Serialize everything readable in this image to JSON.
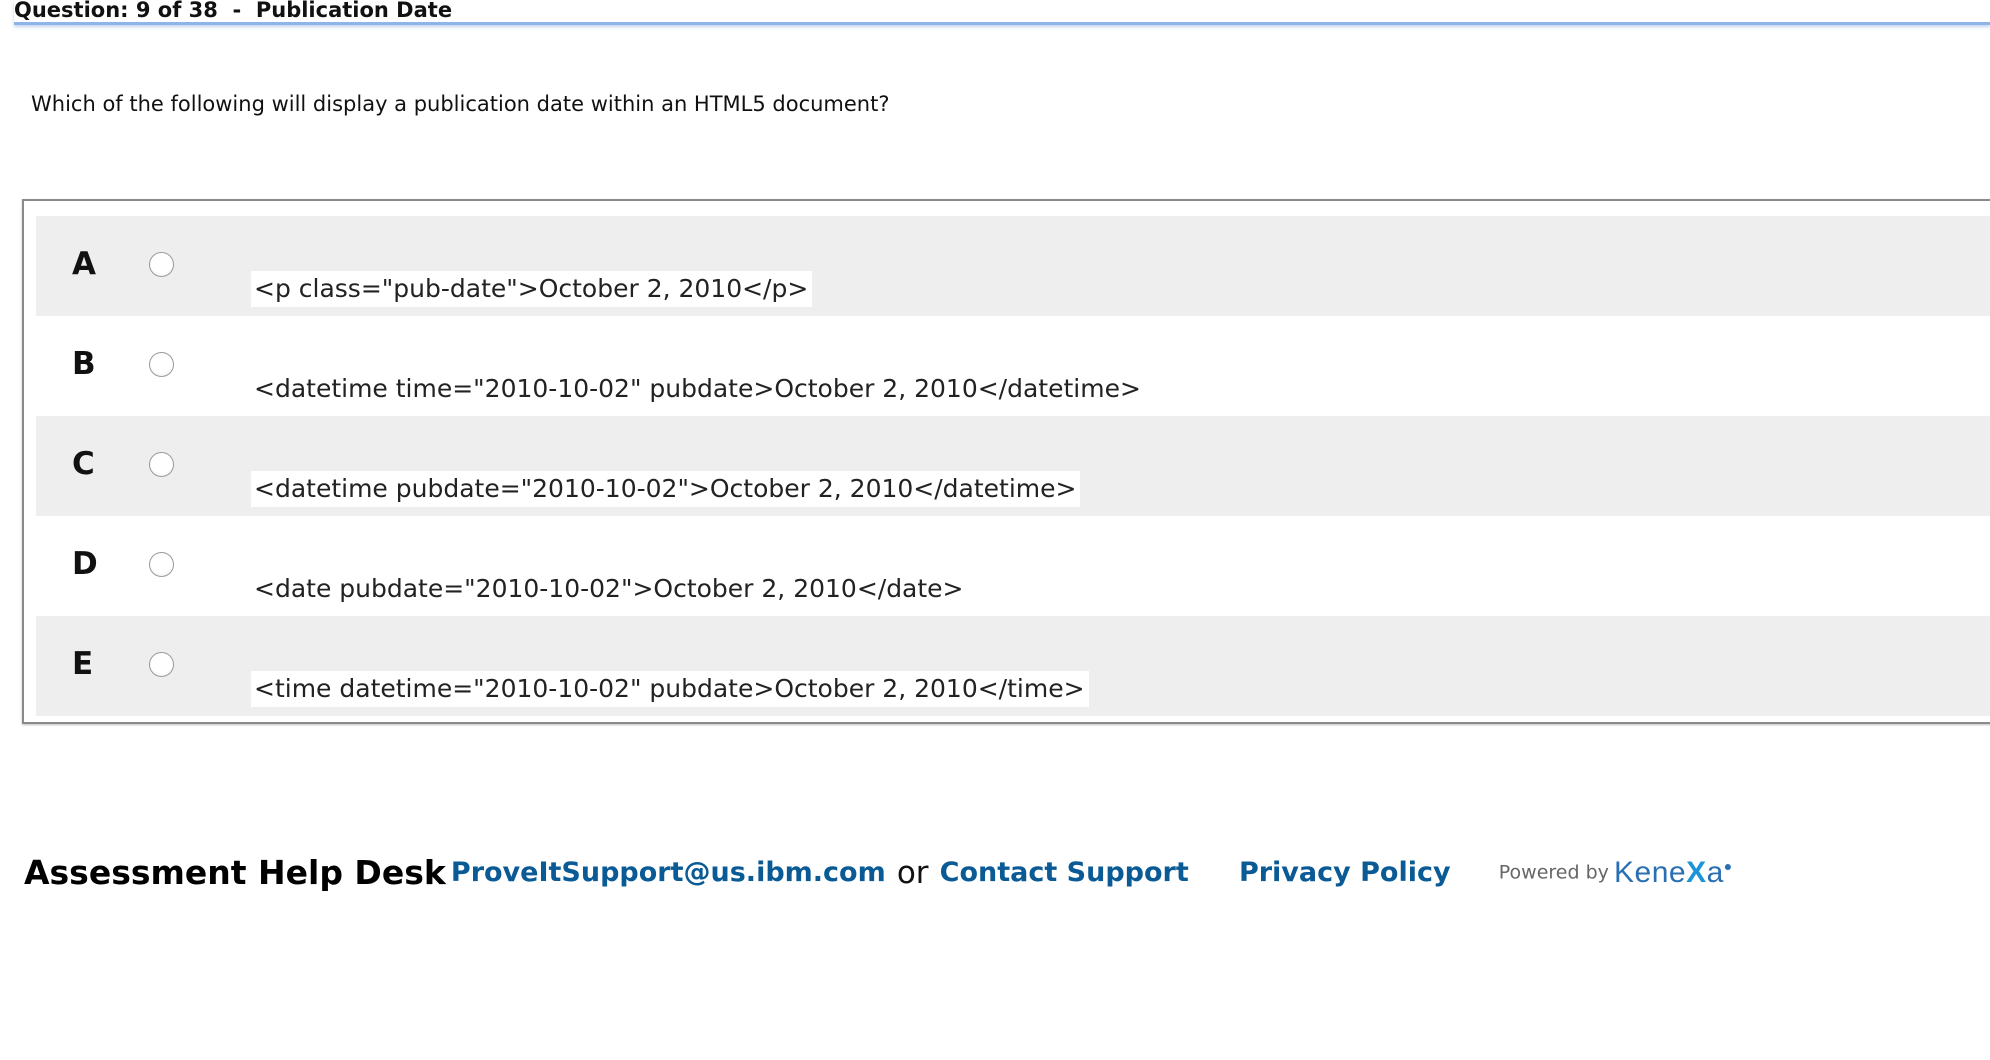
{
  "header": {
    "question_label": "Question: 9 of 38",
    "separator": "-",
    "title": "Publication Date"
  },
  "question": {
    "text": "Which of the following will display a publication date within an HTML5 document?"
  },
  "options": [
    {
      "letter": "A",
      "code": "<p class=\"pub-date\">October 2, 2010</p>"
    },
    {
      "letter": "B",
      "code": "<datetime time=\"2010-10-02\" pubdate>October 2, 2010</datetime>"
    },
    {
      "letter": "C",
      "code": "<datetime pubdate=\"2010-10-02\">October 2, 2010</datetime>"
    },
    {
      "letter": "D",
      "code": "<date pubdate=\"2010-10-02\">October 2, 2010</date>"
    },
    {
      "letter": "E",
      "code": "<time datetime=\"2010-10-02\" pubdate>October 2, 2010</time>"
    }
  ],
  "footer": {
    "help_desk_label": "Assessment Help Desk",
    "email_link": "ProveItSupport@us.ibm.com",
    "or_text": "or",
    "contact_link": "Contact Support",
    "privacy_link": "Privacy Policy",
    "powered_by": "Powered by",
    "brand_prefix": "Kene",
    "brand_x": "X",
    "brand_suffix": "a",
    "link_color": "#0a5a96"
  }
}
